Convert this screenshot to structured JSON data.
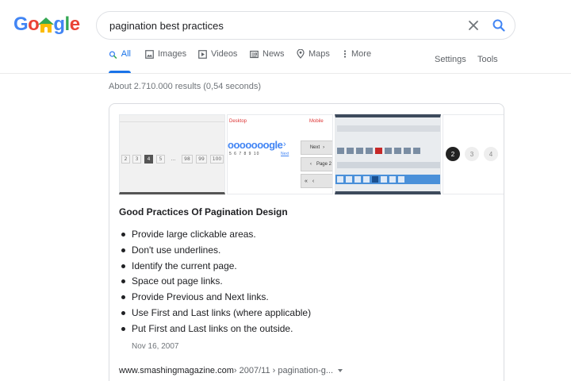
{
  "logo": {
    "text_parts": [
      "G",
      "o",
      "o",
      "g",
      "l",
      "e"
    ],
    "colors": [
      "#4285f4",
      "#ea4335",
      "#fbbc05",
      "#4285f4",
      "#34a853",
      "#ea4335"
    ]
  },
  "search": {
    "value": "pagination best practices",
    "placeholder": ""
  },
  "tabs": {
    "all": "All",
    "images": "Images",
    "videos": "Videos",
    "news": "News",
    "maps": "Maps",
    "more": "More",
    "settings": "Settings",
    "tools": "Tools"
  },
  "result_stats": "About 2.710.000 results (0,54 seconds)",
  "snippet": {
    "thumbnails": {
      "thumb1_pages": [
        "2",
        "3",
        "4",
        "5",
        "...",
        "98",
        "99",
        "100"
      ],
      "thumb2": {
        "desktop_label": "Desktop",
        "mobile_label": "Mobile",
        "logo_text": "ooooooogle",
        "page_numbers": "5 6 7 8 9 10",
        "next_short": "Next",
        "next_label": "Next",
        "page_label": "Page 2"
      },
      "thumb4_pages": [
        "2",
        "3",
        "4"
      ]
    },
    "title": "Good Practices Of Pagination Design",
    "bullets": [
      "Provide large clickable areas.",
      "Don't use underlines.",
      "Identify the current page.",
      "Space out page links.",
      "Provide Previous and Next links.",
      "Use First and Last links (where applicable)",
      "Put First and Last links on the outside."
    ],
    "date": "Nov 16, 2007",
    "source": {
      "domain": "www.smashingmagazine.com",
      "path": " › 2007/11 › pagination-g..."
    }
  },
  "colors": {
    "accent": "#1a73e8",
    "text": "#202124",
    "muted": "#70757a"
  }
}
